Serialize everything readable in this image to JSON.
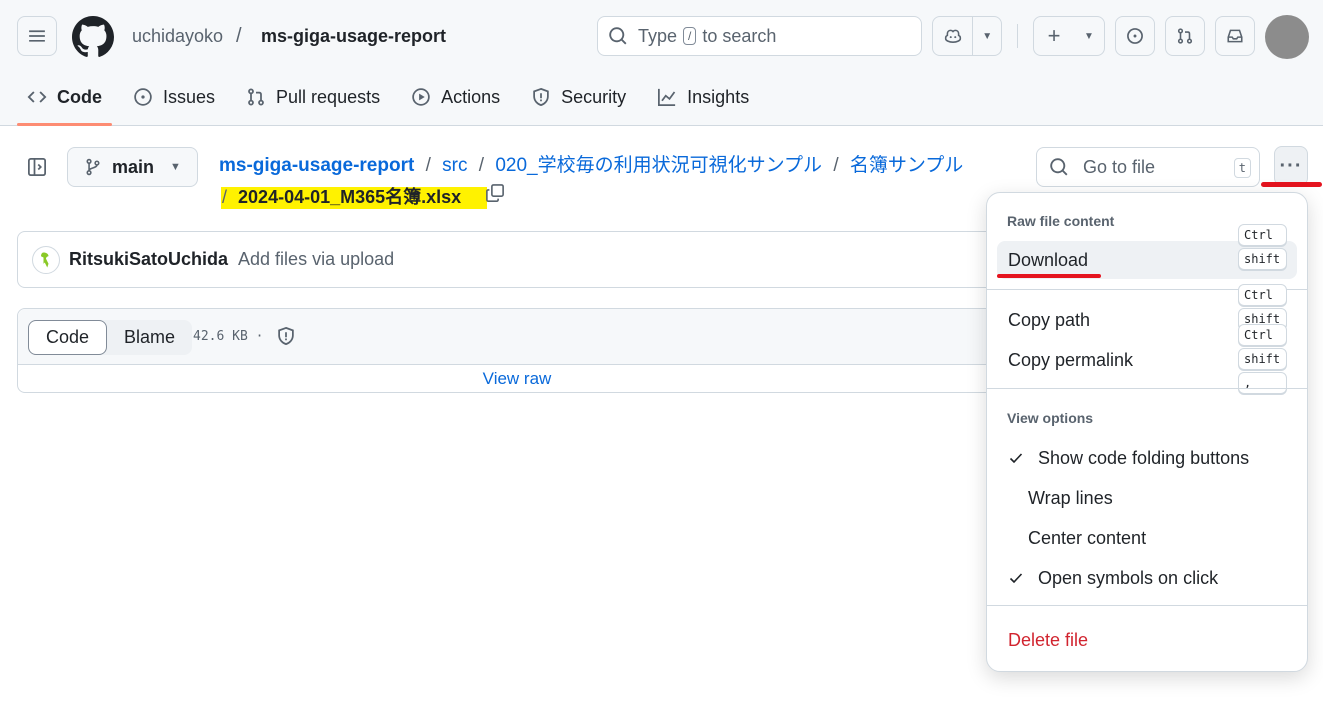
{
  "header": {
    "owner": "uchidayoko",
    "separator": "/",
    "repo": "ms-giga-usage-report",
    "search": {
      "prefix": "Type",
      "key": "/",
      "suffix": "to search"
    }
  },
  "tabs": [
    {
      "label": "Code",
      "icon": "code-icon",
      "active": true
    },
    {
      "label": "Issues",
      "icon": "issue-opened-icon"
    },
    {
      "label": "Pull requests",
      "icon": "git-pull-request-icon"
    },
    {
      "label": "Actions",
      "icon": "play-icon"
    },
    {
      "label": "Security",
      "icon": "shield-icon"
    },
    {
      "label": "Insights",
      "icon": "graph-icon"
    }
  ],
  "branch": {
    "name": "main"
  },
  "breadcrumb": {
    "root": "ms-giga-usage-report",
    "sep": "/",
    "parts": [
      "src",
      "020_学校毎の利用状況可視化サンプル",
      "名簿サンプル"
    ],
    "filename": "2024-04-01_M365名簿.xlsx"
  },
  "goto": {
    "placeholder": "Go to file",
    "key": "t"
  },
  "commit": {
    "author": "RitsukiSatoUchida",
    "message": "Add files via upload"
  },
  "file": {
    "tab_code": "Code",
    "tab_blame": "Blame",
    "size": "42.6 KB ·",
    "view_raw": "View raw"
  },
  "menu": {
    "group_raw": "Raw file content",
    "download": "Download",
    "copy_path": "Copy path",
    "copy_permalink": "Copy permalink",
    "group_view": "View options",
    "show_folding": "Show code folding buttons",
    "wrap_lines": "Wrap lines",
    "center_content": "Center content",
    "open_symbols": "Open symbols on click",
    "delete_file": "Delete file",
    "shortcuts": [
      "Ctrl",
      "shift",
      "Ctrl",
      "shift",
      "Ctrl",
      "shift",
      ","
    ]
  },
  "colors": {
    "accent_link": "#0969da",
    "danger": "#d1242f",
    "highlight": "#fff200",
    "annotation_red": "#e5141f"
  }
}
